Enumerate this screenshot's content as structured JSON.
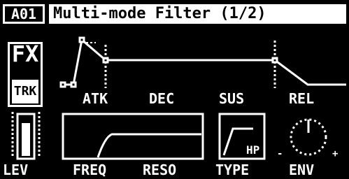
{
  "header": {
    "track_id": "A01",
    "title": "Multi-mode Filter (1/2)"
  },
  "fx_badge": {
    "line1": "FX",
    "line2": "TRK"
  },
  "envelope": {
    "attack_label": "ATK",
    "decay_label": "DEC",
    "sustain_label": "SUS",
    "release_label": "REL"
  },
  "params": {
    "level_label": "LEV",
    "freq_label": "FREQ",
    "reso_label": "RESO",
    "type_label": "TYPE",
    "type_value": "HP",
    "env_label": "ENV",
    "env_minus": "-",
    "env_plus": "+"
  },
  "colors": {
    "foreground": "#ffffff",
    "background": "#000000"
  }
}
